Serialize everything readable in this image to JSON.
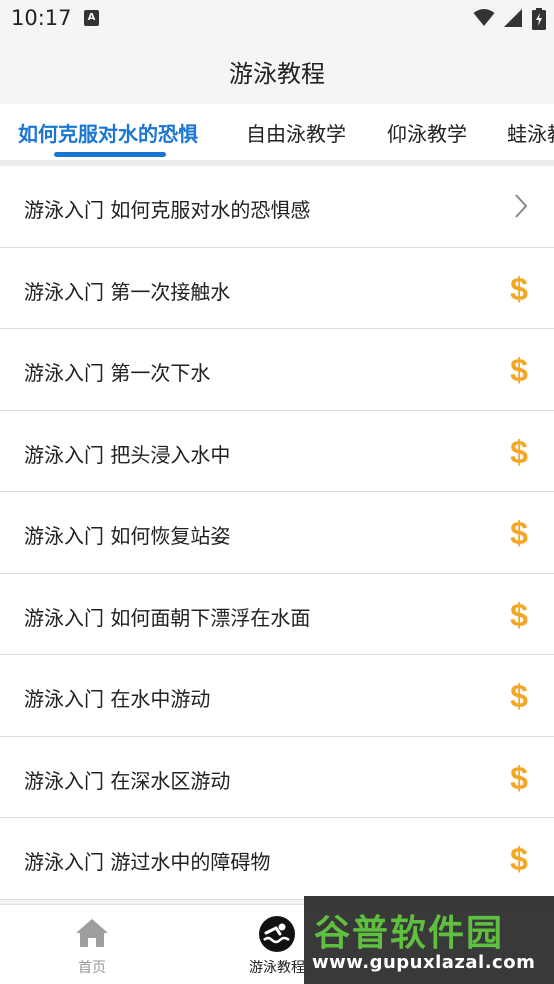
{
  "status_bar": {
    "time": "10:17",
    "notification_icon": "text-a-icon",
    "wifi_icon": "wifi-icon",
    "signal_icon": "cell-signal-icon",
    "battery_icon": "battery-charging-icon"
  },
  "header": {
    "title": "游泳教程"
  },
  "tabs": [
    {
      "label": "如何克服对水的恐惧",
      "active": true
    },
    {
      "label": "自由泳教学",
      "active": false
    },
    {
      "label": "仰泳教学",
      "active": false
    },
    {
      "label": "蛙泳教学",
      "active": false
    }
  ],
  "list": {
    "items": [
      {
        "title": "游泳入门 如何克服对水的恐惧感",
        "icon": "chevron-right-icon"
      },
      {
        "title": "游泳入门 第一次接触水",
        "icon": "dollar-icon"
      },
      {
        "title": "游泳入门 第一次下水",
        "icon": "dollar-icon"
      },
      {
        "title": "游泳入门 把头浸入水中",
        "icon": "dollar-icon"
      },
      {
        "title": "游泳入门 如何恢复站姿",
        "icon": "dollar-icon"
      },
      {
        "title": "游泳入门 如何面朝下漂浮在水面",
        "icon": "dollar-icon"
      },
      {
        "title": "游泳入门 在水中游动",
        "icon": "dollar-icon"
      },
      {
        "title": "游泳入门 在深水区游动",
        "icon": "dollar-icon"
      },
      {
        "title": "游泳入门 游过水中的障碍物",
        "icon": "dollar-icon"
      }
    ]
  },
  "bottom_nav": {
    "items": [
      {
        "label": "首页",
        "icon": "home-icon"
      },
      {
        "label": "游泳教程",
        "icon": "swimmer-icon"
      }
    ]
  },
  "watermark": {
    "title": "谷普软件园",
    "url": "www.gupuxlazal.com"
  },
  "colors": {
    "accent": "#1976d2",
    "premium": "#f5a623",
    "background": "#f3f3f3"
  }
}
